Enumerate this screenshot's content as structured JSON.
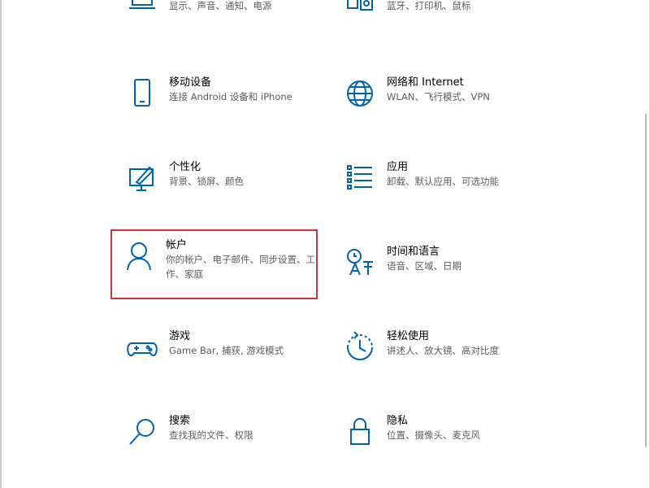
{
  "colors": {
    "accent": "#0063b1",
    "selection": "#d13438",
    "desc": "#5d5d5d"
  },
  "tiles": [
    {
      "icon": "laptop-icon",
      "title": "",
      "desc": "显示、声音、通知、电源"
    },
    {
      "icon": "devices-icon",
      "title": "",
      "desc": "蓝牙、打印机、鼠标"
    },
    {
      "icon": "phone-icon",
      "title": "移动设备",
      "desc": "连接 Android 设备和 iPhone"
    },
    {
      "icon": "globe-icon",
      "title": "网络和 Internet",
      "desc": "WLAN、飞行模式、VPN"
    },
    {
      "icon": "personalization-icon",
      "title": "个性化",
      "desc": "背景、锁屏、颜色"
    },
    {
      "icon": "apps-list-icon",
      "title": "应用",
      "desc": "卸载、默认应用、可选功能"
    },
    {
      "icon": "person-icon",
      "title": "帐户",
      "desc": "你的帐户、电子邮件、同步设置、工作、家庭"
    },
    {
      "icon": "time-language-icon",
      "title": "时间和语言",
      "desc": "语音、区域、日期"
    },
    {
      "icon": "gamepad-icon",
      "title": "游戏",
      "desc": "Game Bar, 捕获, 游戏模式"
    },
    {
      "icon": "accessibility-icon",
      "title": "轻松使用",
      "desc": "讲述人、放大镜、高对比度"
    },
    {
      "icon": "search-icon",
      "title": "搜索",
      "desc": "查找我的文件、权限"
    },
    {
      "icon": "lock-icon",
      "title": "隐私",
      "desc": "位置、摄像头、麦克风"
    }
  ]
}
